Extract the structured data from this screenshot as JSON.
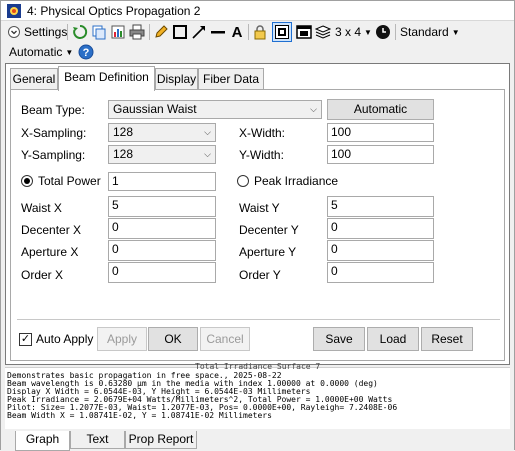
{
  "window": {
    "title": "4: Physical Optics Propagation 2"
  },
  "toolbar": {
    "settings_label": "Settings",
    "layout_label": "3 x 4",
    "standard_label": "Standard",
    "automatic_label": "Automatic"
  },
  "tabs": [
    "General",
    "Beam Definition",
    "Display",
    "Fiber Data"
  ],
  "beam": {
    "beam_type_label": "Beam Type:",
    "beam_type_value": "Gaussian Waist",
    "automatic_button": "Automatic",
    "x_sampling_label": "X-Sampling:",
    "x_sampling_value": "128",
    "y_sampling_label": "Y-Sampling:",
    "y_sampling_value": "128",
    "x_width_label": "X-Width:",
    "x_width_value": "100",
    "y_width_label": "Y-Width:",
    "y_width_value": "100",
    "total_power_label": "Total Power",
    "total_power_value": "1",
    "peak_irradiance_label": "Peak Irradiance",
    "waist_x_label": "Waist X",
    "waist_x_value": "5",
    "waist_y_label": "Waist Y",
    "waist_y_value": "5",
    "decenter_x_label": "Decenter X",
    "decenter_x_value": "0",
    "decenter_y_label": "Decenter Y",
    "decenter_y_value": "0",
    "aperture_x_label": "Aperture X",
    "aperture_x_value": "0",
    "aperture_y_label": "Aperture Y",
    "aperture_y_value": "0",
    "order_x_label": "Order X",
    "order_x_value": "0",
    "order_y_label": "Order Y",
    "order_y_value": "0"
  },
  "buttons": {
    "auto_apply": "Auto Apply",
    "apply": "Apply",
    "ok": "OK",
    "cancel": "Cancel",
    "save": "Save",
    "load": "Load",
    "reset": "Reset"
  },
  "text_output": {
    "lines": [
      "Total Irradiance Surface 7",
      "Demonstrates basic propagation in free space., 2025-08-22",
      "Beam wavelength is 0.63280 µm in the media with index 1.00000 at 0.0000 (deg)",
      "Display X Width = 6.0544E-03, Y Height = 6.0544E-03 Millimeters",
      "Peak Irradiance = 2.0679E+04 Watts/Millimeters^2, Total Power = 1.0000E+00 Watts",
      "Pilot: Size= 1.2077E-03, Waist= 1.2077E-03, Pos= 0.0000E+00, Rayleigh= 7.2408E-06",
      "Beam Width X = 1.08741E-02, Y = 1.08741E-02 Millimeters"
    ]
  },
  "bottom_tabs": [
    "Graph",
    "Text",
    "Prop Report"
  ],
  "colors": {
    "accent": "#0078d7",
    "focus": "#1f6fd1"
  }
}
